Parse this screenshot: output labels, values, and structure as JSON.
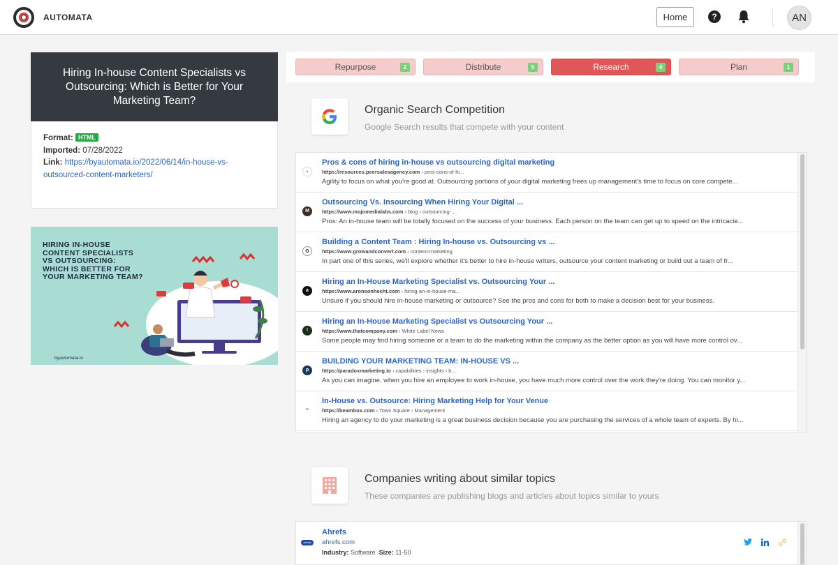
{
  "header": {
    "brand": "AUTOMATA",
    "home_label": "Home",
    "help_glyph": "?",
    "avatar_initials": "AN"
  },
  "article": {
    "title": "Hiring In-house Content Specialists vs Outsourcing: Which is Better for Your Marketing Team?",
    "format_label": "Format:",
    "format_value": "HTML",
    "imported_label": "Imported:",
    "imported_value": "07/28/2022",
    "link_label": "Link:",
    "link_value": "https://byautomata.io/2022/06/14/in-house-vs-outsourced-content-marketers/",
    "thumbnail_lines": [
      "HIRING IN-HOUSE",
      "CONTENT SPECIALISTS",
      "VS OUTSOURCING:",
      "WHICH IS BETTER FOR",
      "YOUR MARKETING TEAM?"
    ],
    "thumbnail_footer": "byautomata.io"
  },
  "tabs": [
    {
      "label": "Repurpose",
      "count": "2",
      "active": false
    },
    {
      "label": "Distribute",
      "count": "5",
      "active": false
    },
    {
      "label": "Research",
      "count": "4",
      "active": true
    },
    {
      "label": "Plan",
      "count": "1",
      "active": false
    }
  ],
  "organic": {
    "icon": "google-icon",
    "title": "Organic Search Competition",
    "subtitle": "Google Search results that compete with your content",
    "results": [
      {
        "title": "Pros & cons of hiring in-house vs outsourcing digital marketing",
        "domain": "https://resources.peersalesagency.com",
        "path": " › pros-cons-of-hi...",
        "snippet": "Agility to focus on what you're good at. Outsourcing portions of your digital marketing frees up management's time to focus on core compete...",
        "fav": "▪"
      },
      {
        "title": "Outsourcing Vs. Insourcing When Hiring Your Digital ...",
        "domain": "https://www.mojomedialabs.com",
        "path": " › blog › outsourcing-...",
        "snippet": "Pros: An in-house team will be totally focused on the success of your business. Each person on the team can get up to speed on the intricacie...",
        "fav": "M"
      },
      {
        "title": "Building a Content Team : Hiring In-house vs. Outsourcing vs ...",
        "domain": "https://www.growandconvert.com",
        "path": " › content-marketing",
        "snippet": "In part one of this series, we'll explore whether it's better to hire in-house writers, outsource your content marketing or build out a team of fr...",
        "fav": "G"
      },
      {
        "title": "Hiring an In-House Marketing Specialist vs. Outsourcing Your ...",
        "domain": "https://www.aronsonhecht.com",
        "path": " › hiring-an-in-house-ma...",
        "snippet": "Unsure if you should hire in-house marketing or outsource? See the pros and cons for both to make a decision best for your business.",
        "fav": "a"
      },
      {
        "title": "Hiring an In-House Marketing Specialist vs Outsourcing Your ...",
        "domain": "https://www.thatcompany.com",
        "path": " › White Label News",
        "snippet": "Some people may find hiring someone or a team to do the marketing within the company as the better option as you will have more control ov...",
        "fav": "t"
      },
      {
        "title": "BUILDING YOUR MARKETING TEAM: IN-HOUSE VS ...",
        "domain": "https://paradoxmarketing.io",
        "path": " › capabilities › insights › b...",
        "snippet": "As you can imagine, when you hire an employee to work in-house, you have much more control over the work they're doing. You can monitor y...",
        "fav": "p"
      },
      {
        "title": "In-House vs. Outsource: Hiring Marketing Help for Your Venue",
        "domain": "https://beambox.com",
        "path": " › Town Square › Management",
        "snippet": "Hiring an agency to do your marketing is a great business decision because you are purchasing the services of a whole team of experts. By hi...",
        "fav": "≈"
      }
    ]
  },
  "companies": {
    "icon": "building-icon",
    "title": "Companies writing about similar topics",
    "subtitle": "These companies are publishing blogs and articles about topics similar to yours",
    "items": [
      {
        "name": "Ahrefs",
        "domain": "ahrefs.com",
        "industry_label": "Industry:",
        "industry": "Software",
        "size_label": "Size:",
        "size": "11-50",
        "logo_text": "ahrefs"
      }
    ]
  },
  "colors": {
    "accent_red": "#e15757",
    "tab_light": "#f6cbcb",
    "link_blue": "#2b66c7",
    "badge_green": "#28a745",
    "dark_header": "#343a40"
  }
}
